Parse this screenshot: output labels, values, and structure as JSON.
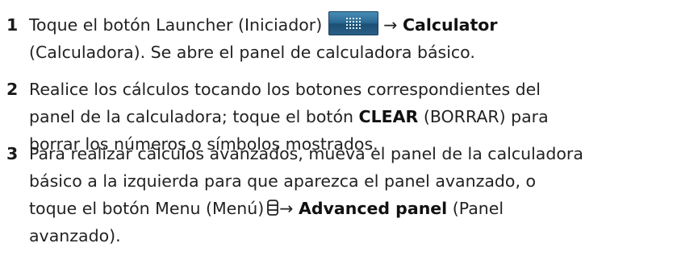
{
  "steps": [
    {
      "number": "1",
      "line1": {
        "a": "Toque el botón Launcher (Iniciador)",
        "arrow": "→",
        "b": "Calculator"
      },
      "line2": "(Calculadora). Se abre el panel de calculadora básico."
    },
    {
      "number": "2",
      "line1": "Realice los cálculos tocando los botones correspondientes del",
      "line2": {
        "a": "panel de la calculadora; toque el botón",
        "b": "CLEAR",
        "c": "(BORRAR) para"
      },
      "line3": "borrar los números o símbolos mostrados."
    },
    {
      "number": "3",
      "line1": "Para realizar cálculos avanzados, mueva el panel de la calculadora",
      "line2": "básico a la izquierda para que aparezca el panel avanzado, o",
      "line3": {
        "a": "toque el botón Menu (Menú)",
        "arrow": "→",
        "b": "Advanced panel",
        "c": "(Panel"
      },
      "line4": "avanzado)."
    }
  ],
  "icons": {
    "launcher": "launcher-grid-icon",
    "menu": "menu-icon"
  },
  "colors": {
    "launcher_button": "#2c6b95",
    "text": "#222222"
  }
}
